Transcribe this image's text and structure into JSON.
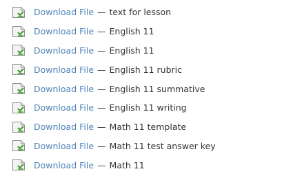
{
  "files": [
    {
      "link_label": "Download File",
      "separator": "—",
      "description": "text for lesson",
      "icon": "document-icon"
    },
    {
      "link_label": "Download File",
      "separator": "—",
      "description": "English 11",
      "icon": "document-icon"
    },
    {
      "link_label": "Download File",
      "separator": "—",
      "description": "English 11",
      "icon": "document-icon"
    },
    {
      "link_label": "Download File",
      "separator": "—",
      "description": "English 11 rubric",
      "icon": "document-icon"
    },
    {
      "link_label": "Download File",
      "separator": "—",
      "description": "English 11 summative",
      "icon": "document-icon"
    },
    {
      "link_label": "Download File",
      "separator": "—",
      "description": "English 11 writing",
      "icon": "document-icon"
    },
    {
      "link_label": "Download File",
      "separator": "—",
      "description": "Math 11 template",
      "icon": "document-icon"
    },
    {
      "link_label": "Download File",
      "separator": "—",
      "description": "Math 11 test answer key",
      "icon": "document-icon"
    },
    {
      "link_label": "Download File",
      "separator": "—",
      "description": "Math 11",
      "icon": "document-icon"
    }
  ],
  "colors": {
    "link": "#4f83b8",
    "text": "#333333",
    "icon_accent": "#3f9a2d"
  }
}
